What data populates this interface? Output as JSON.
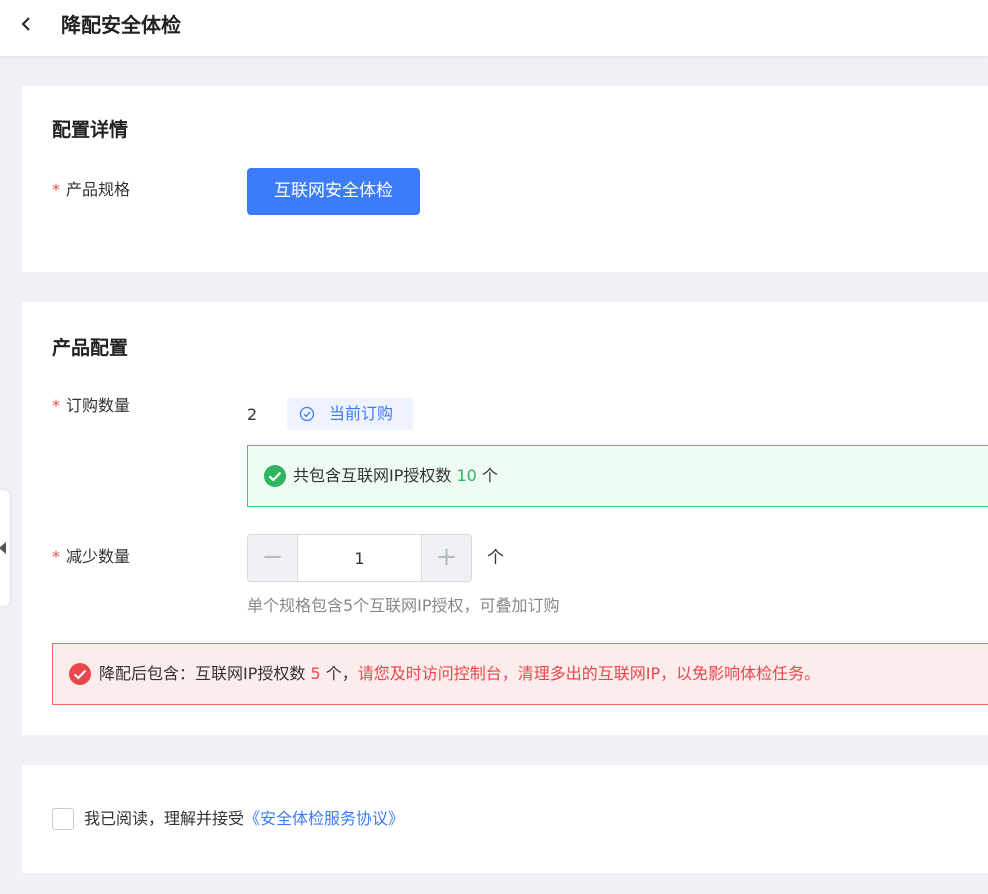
{
  "header": {
    "title": "降配安全体检",
    "back_icon": "chevron-left-icon"
  },
  "config_detail": {
    "section_title": "配置详情",
    "spec_label": "产品规格",
    "required_mark": "*",
    "spec_value": "互联网安全体检",
    "accent_color": "#3d7cf8"
  },
  "product_config": {
    "section_title": "产品配置",
    "order_qty_label": "订购数量",
    "order_qty_value": "2",
    "current_tag": "当前订购",
    "current_tag_icon": "check-circle-outline-icon",
    "success_info": {
      "prefix": "共包含互联网IP授权数 ",
      "count": "10",
      "suffix": " 个",
      "icon": "check-circle-icon",
      "color": "#2fb55f"
    },
    "reduce_qty_label": "减少数量",
    "stepper": {
      "minus": "−",
      "value": "1",
      "plus": "+"
    },
    "unit": "个",
    "hint": "单个规格包含5个互联网IP授权，可叠加订购",
    "warning": {
      "prefix": "降配后包含：互联网IP授权数 ",
      "count": "5",
      "middle": " 个，",
      "red_text": "请您及时访问控制台，清理多出的互联网IP，以免影响体检任务。",
      "icon": "check-circle-icon",
      "color": "#e8484b"
    }
  },
  "agreement": {
    "text": "我已阅读，理解并接受",
    "link": "《安全体检服务协议》",
    "checked": false
  }
}
